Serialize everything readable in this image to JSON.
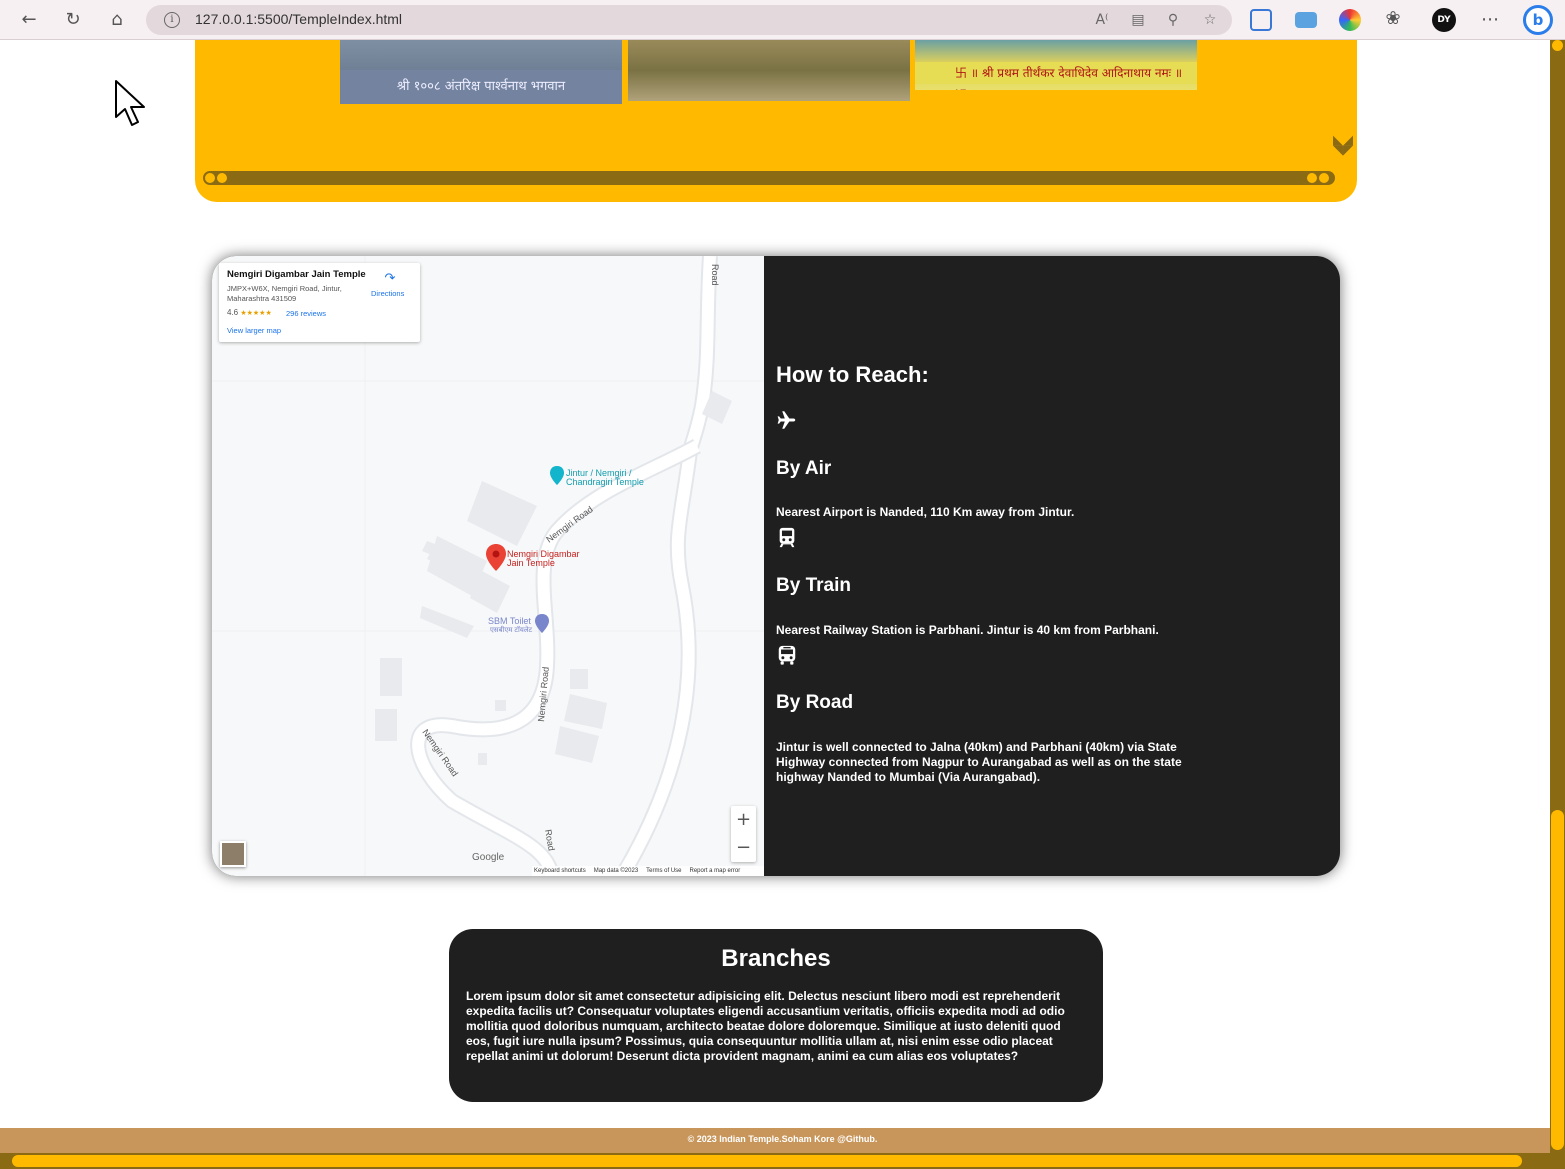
{
  "browser": {
    "url": "127.0.0.1:5500/TempleIndex.html",
    "profile_initials": "DY",
    "bing_label": "b"
  },
  "gallery": {
    "photo1_caption": "श्री १००८ अंतरिक्ष पार्श्वनाथ भगवान",
    "photo3_caption": "卐 ॥ श्री प्रथम तीर्थंकर देवाधिदेव आदिनाथाय नमः ॥ 卐"
  },
  "map": {
    "place_title": "Nemgiri Digambar Jain Temple",
    "place_address": "JMPX+W6X, Nemgiri Road, Jintur, Maharashtra 431509",
    "rating": "4.6",
    "stars": "★★★★★",
    "reviews": "296 reviews",
    "view_larger": "View larger map",
    "directions": "Directions",
    "label_jintur": "Jintur / Nemgiri / Chandragiri Temple",
    "label_temple": "Nemgiri Digambar Jain Temple",
    "label_toilet": "SBM Toilet",
    "label_toilet_sub": "एसबीएम टॉयलेट",
    "road_label": "Road",
    "nemgiri_road": "Nemgiri Road",
    "zoom_in": "+",
    "zoom_out": "−",
    "google": "Google",
    "attrib_shortcuts": "Keyboard shortcuts",
    "attrib_data": "Map data ©2023",
    "attrib_terms": "Terms of Use",
    "attrib_report": "Report a map error"
  },
  "reach": {
    "title": "How to Reach:",
    "air": {
      "icon": "plane-icon",
      "title": "By Air",
      "desc": "Nearest Airport is Nanded, 110 Km away from Jintur."
    },
    "train": {
      "icon": "train-icon",
      "title": "By Train",
      "desc": "Nearest Railway Station is Parbhani. Jintur is 40 km from Parbhani."
    },
    "road": {
      "icon": "bus-icon",
      "title": "By Road",
      "desc": "Jintur is well connected to Jalna (40km) and Parbhani (40km) via State Highway connected from Nagpur to Aurangabad as well as on the state highway Nanded to Mumbai (Via Aurangabad)."
    }
  },
  "branches": {
    "title": "Branches",
    "text": "Lorem ipsum dolor sit amet consectetur adipisicing elit. Delectus nesciunt libero modi est reprehenderit expedita facilis ut? Consequatur voluptates eligendi accusantium veritatis, officiis expedita modi ad odio mollitia quod doloribus numquam, architecto beatae dolore doloremque. Similique at iusto deleniti quod eos, fugit iure nulla ipsum? Possimus, quia consequuntur mollitia ullam at, nisi enim esse odio placeat repellat animi ut dolorum! Deserunt dicta provident magnam, animi ea cum alias eos voluptates?"
  },
  "footer": {
    "text": "© 2023 Indian Temple.Soham Kore @Github."
  },
  "colors": {
    "accent": "#ffba00",
    "dark_panel": "#1f1f1f",
    "footer": "#c8965a",
    "rail": "#8b6a14"
  }
}
